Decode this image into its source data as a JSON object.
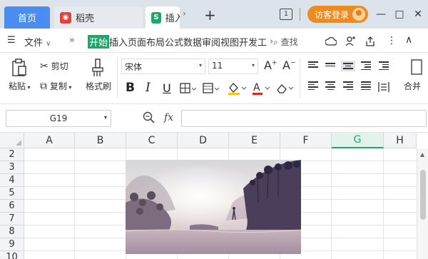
{
  "tabbar": {
    "home_label": "首页",
    "doc_tab_label": "稻壳",
    "sheet_tab_label": "插入",
    "add_tab": "+",
    "arrow": "›"
  },
  "top_right": {
    "num_icon": "1",
    "login_label": "访客登录",
    "minimize": "—",
    "restore": "□",
    "close": "✕"
  },
  "menubar": {
    "file_label": "文件",
    "more_label": "»",
    "start_label": "开始",
    "tabs_text": "插入页面布局公式数据审阅视图开发工",
    "tabs_arrow": "›",
    "search_label": "查找"
  },
  "ribbon": {
    "paste_label": "粘贴",
    "cut_label": "剪切",
    "copy_label": "复制",
    "format_painter_label": "格式刷",
    "font_name": "宋体",
    "font_size": "11",
    "bold": "B",
    "italic": "I",
    "underline": "U",
    "merge_label": "合并"
  },
  "formula_bar": {
    "cell_ref": "G19",
    "fx": "fx"
  },
  "grid": {
    "columns": [
      "A",
      "B",
      "C",
      "D",
      "E",
      "F",
      "G",
      "H"
    ],
    "active_column": "G",
    "rows": [
      "2",
      "3",
      "4",
      "5",
      "6",
      "7",
      "8",
      "9",
      "10"
    ]
  },
  "colors": {
    "accent_green": "#1aa86b",
    "home_tab_blue": "#4a8cf0",
    "login_orange": "#ee8b1f",
    "doc_icon_red": "#e0413b"
  }
}
